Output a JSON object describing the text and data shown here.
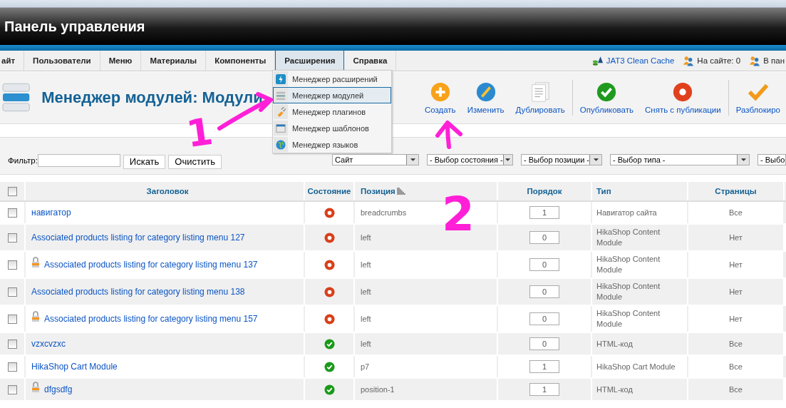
{
  "header": {
    "title": "Панель управления"
  },
  "menu": [
    {
      "label": "айт",
      "selected": false
    },
    {
      "label": "Пользователи",
      "selected": false
    },
    {
      "label": "Меню",
      "selected": false
    },
    {
      "label": "Материалы",
      "selected": false
    },
    {
      "label": "Компоненты",
      "selected": false
    },
    {
      "label": "Расширения",
      "selected": true
    },
    {
      "label": "Справка",
      "selected": false
    }
  ],
  "status_links": [
    {
      "label": "JAT3 Clean Cache",
      "kind": "cache"
    },
    {
      "label": "На сайте: 0",
      "kind": "users"
    },
    {
      "label": "В пан",
      "kind": "users"
    }
  ],
  "dropdown": [
    {
      "label": "Менеджер расширений",
      "kind": "extensions",
      "selected": false
    },
    {
      "label": "Менеджер модулей",
      "kind": "modules",
      "selected": true
    },
    {
      "label": "Менеджер плагинов",
      "kind": "plugins",
      "selected": false
    },
    {
      "label": "Менеджер шаблонов",
      "kind": "templates",
      "selected": false
    },
    {
      "label": "Менеджер языков",
      "kind": "languages",
      "selected": false
    }
  ],
  "page_title": "Менеджер модулей: Модули",
  "toolbar_groups": [
    {
      "buttons": [
        {
          "label": "Создать",
          "kind": "new"
        },
        {
          "label": "Изменить",
          "kind": "edit"
        },
        {
          "label": "Дублировать",
          "kind": "copy"
        }
      ]
    },
    {
      "buttons": [
        {
          "label": "Опубликовать",
          "kind": "publish"
        },
        {
          "label": "Снять с публикации",
          "kind": "unpublish"
        }
      ]
    },
    {
      "buttons": [
        {
          "label": "Разблокиро",
          "kind": "unlock"
        }
      ]
    }
  ],
  "filter": {
    "label": "Фильтр:",
    "search_button": "Искать",
    "clear_button": "Очистить"
  },
  "selects": [
    {
      "value": "Сайт"
    },
    {
      "value": "- Выбор состояния -"
    },
    {
      "value": "- Выбор позиции -"
    },
    {
      "value": "- Выбор типа -"
    },
    {
      "value": "- Выбо"
    }
  ],
  "table": {
    "select_all": {
      "checked": false
    },
    "columns": [
      {
        "label": "Заголовок"
      },
      {
        "label": "Состояние"
      },
      {
        "label": "Позиция",
        "sorted": true
      },
      {
        "label": "Порядок"
      },
      {
        "label": "Тип"
      },
      {
        "label": "Страницы"
      }
    ],
    "rows": [
      {
        "checked": false,
        "locked": false,
        "title": "навигатор",
        "published": false,
        "position": "breadcrumbs",
        "order": "1",
        "type": "Навигатор сайта",
        "pages": "Все"
      },
      {
        "checked": false,
        "locked": false,
        "title": "Associated products listing for category listing menu 127",
        "published": false,
        "position": "left",
        "order": "0",
        "type": "HikaShop Content Module",
        "pages": "Нет"
      },
      {
        "checked": false,
        "locked": true,
        "title": "Associated products listing for category listing menu 137",
        "published": false,
        "position": "left",
        "order": "0",
        "type": "HikaShop Content Module",
        "pages": "Нет"
      },
      {
        "checked": false,
        "locked": false,
        "title": "Associated products listing for category listing menu 138",
        "published": false,
        "position": "left",
        "order": "0",
        "type": "HikaShop Content Module",
        "pages": "Нет"
      },
      {
        "checked": false,
        "locked": true,
        "title": "Associated products listing for category listing menu 157",
        "published": false,
        "position": "left",
        "order": "0",
        "type": "HikaShop Content Module",
        "pages": "Нет"
      },
      {
        "checked": false,
        "locked": false,
        "title": "vzxcvzxc",
        "published": true,
        "position": "left",
        "order": "0",
        "type": "HTML-код",
        "pages": "Все"
      },
      {
        "checked": false,
        "locked": false,
        "title": "HikaShop Cart Module",
        "published": true,
        "position": "p7",
        "order": "1",
        "type": "HikaShop Cart Module",
        "pages": "Все"
      },
      {
        "checked": false,
        "locked": true,
        "title": "dfgsdfg",
        "published": true,
        "position": "position-1",
        "order": "1",
        "type": "HTML-код",
        "pages": "Все"
      }
    ]
  },
  "annotations": [
    {
      "label": "1"
    },
    {
      "label": "2"
    }
  ]
}
